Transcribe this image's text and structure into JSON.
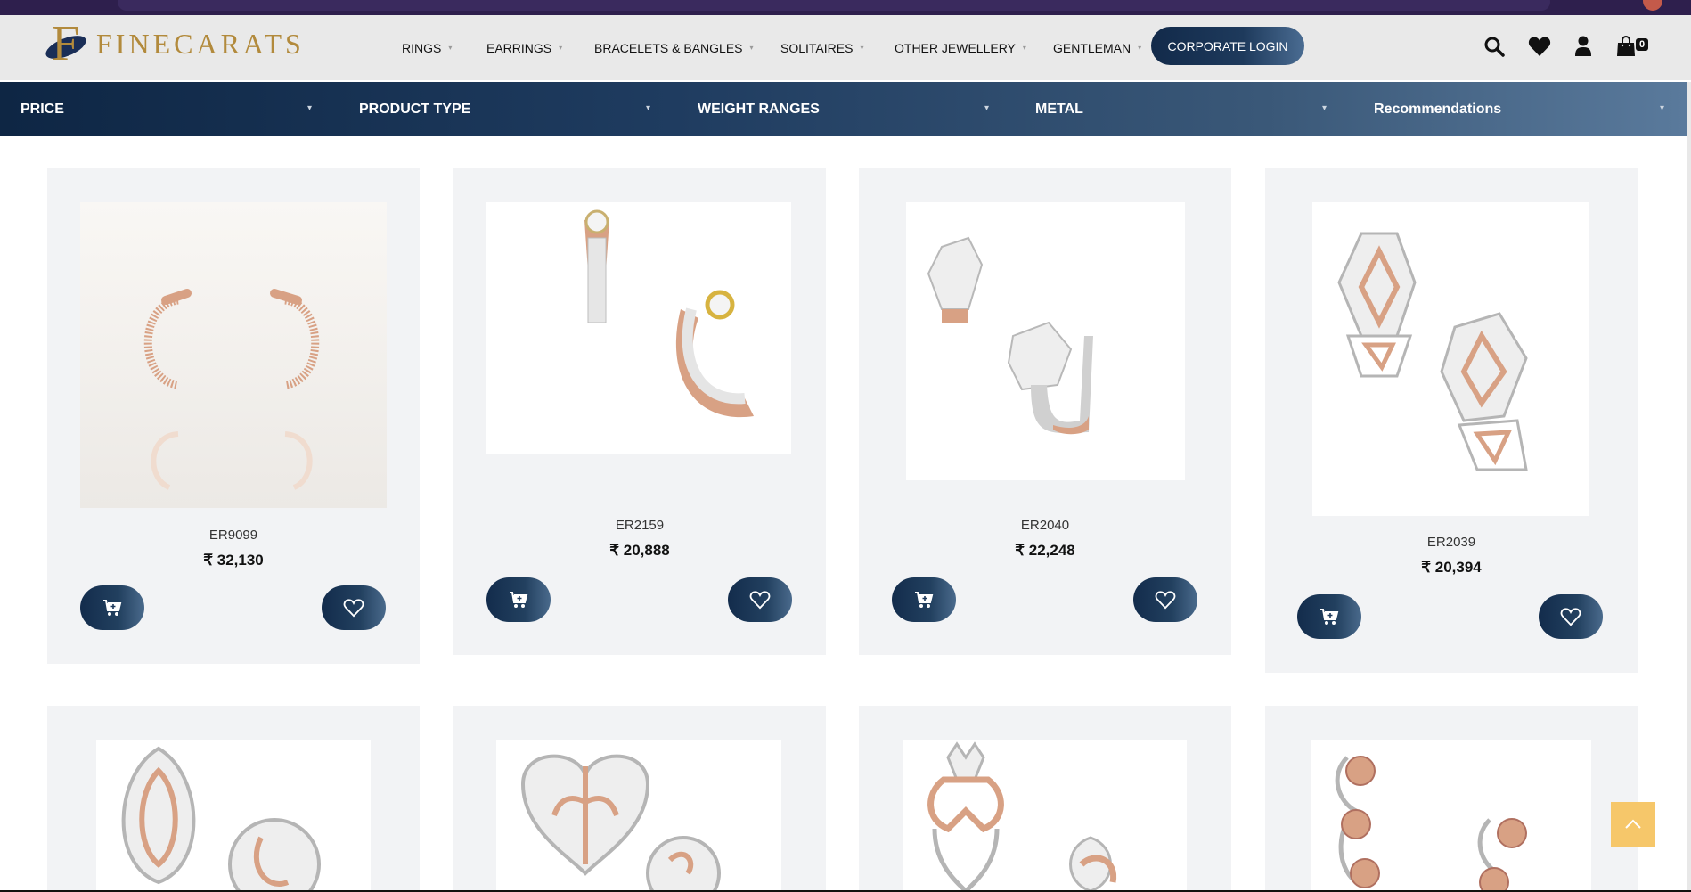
{
  "brand": {
    "name": "FINECARATS",
    "gold": "#b28a3c",
    "navy": "#1a2e57"
  },
  "nav": {
    "items": [
      {
        "label": "RINGS"
      },
      {
        "label": "EARRINGS"
      },
      {
        "label": "BRACELETS & BANGLES"
      },
      {
        "label": "SOLITAIRES"
      },
      {
        "label": "OTHER JEWELLERY"
      },
      {
        "label": "GENTLEMAN"
      }
    ],
    "corporate_login": "CORPORATE LOGIN"
  },
  "header_icons": [
    "search-icon",
    "heart-icon",
    "user-icon",
    "shopping-bag-icon"
  ],
  "cart": {
    "count": "0"
  },
  "filters": [
    {
      "label": "PRICE"
    },
    {
      "label": "PRODUCT TYPE"
    },
    {
      "label": "WEIGHT RANGES"
    },
    {
      "label": "METAL"
    },
    {
      "label": "Recommendations"
    }
  ],
  "products": [
    {
      "sku": "ER9099",
      "price": "₹ 32,130"
    },
    {
      "sku": "ER2159",
      "price": "₹ 20,888"
    },
    {
      "sku": "ER2040",
      "price": "₹ 22,248"
    },
    {
      "sku": "ER2039",
      "price": "₹ 20,394"
    },
    {
      "sku": "",
      "price": ""
    },
    {
      "sku": "",
      "price": ""
    },
    {
      "sku": "",
      "price": ""
    },
    {
      "sku": "",
      "price": ""
    }
  ],
  "colors": {
    "rose_gold": "#d8a184",
    "yellow_gold": "#d7b340",
    "accent_btn": "#1e3a5c",
    "back_to_top": "#f6c76a"
  }
}
